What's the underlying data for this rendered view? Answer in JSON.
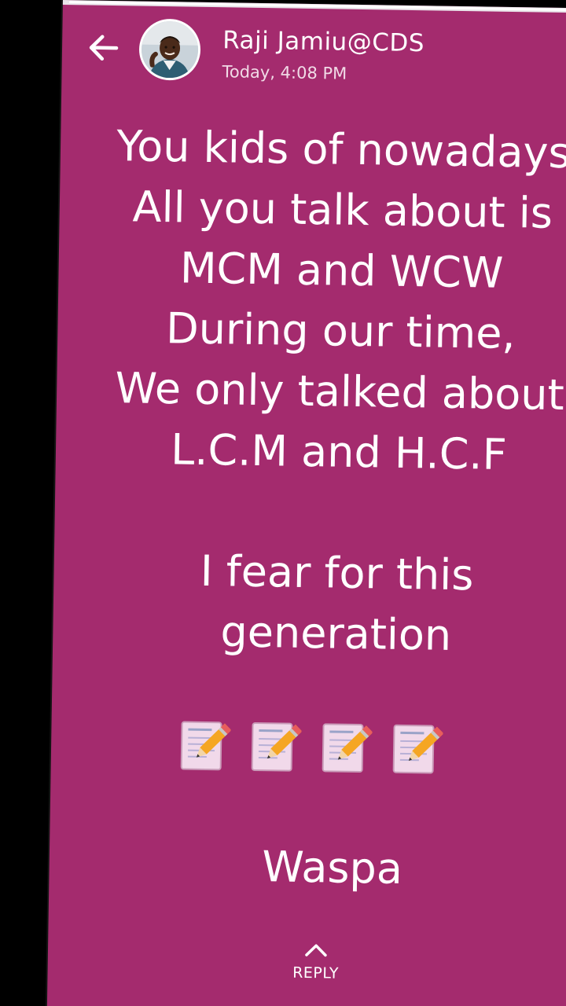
{
  "header": {
    "sender_name": "Raji Jamiu@CDS",
    "timestamp": "Today, 4:08 PM"
  },
  "status": {
    "lines": [
      "You kids of nowadays",
      "All you talk about is",
      "MCM and WCW",
      "During our time,",
      "We only talked about",
      "L.C.M and H.C.F",
      "",
      "I fear for this",
      "generation"
    ],
    "emoji": [
      "memo",
      "memo",
      "memo",
      "memo"
    ],
    "signoff": "Waspa"
  },
  "footer": {
    "reply_label": "REPLY"
  },
  "colors": {
    "background": "#a42b6e",
    "text": "#ffffff"
  },
  "icons": {
    "back": "arrow-left-icon",
    "reply": "chevron-up-icon",
    "emoji": "memo-icon"
  }
}
